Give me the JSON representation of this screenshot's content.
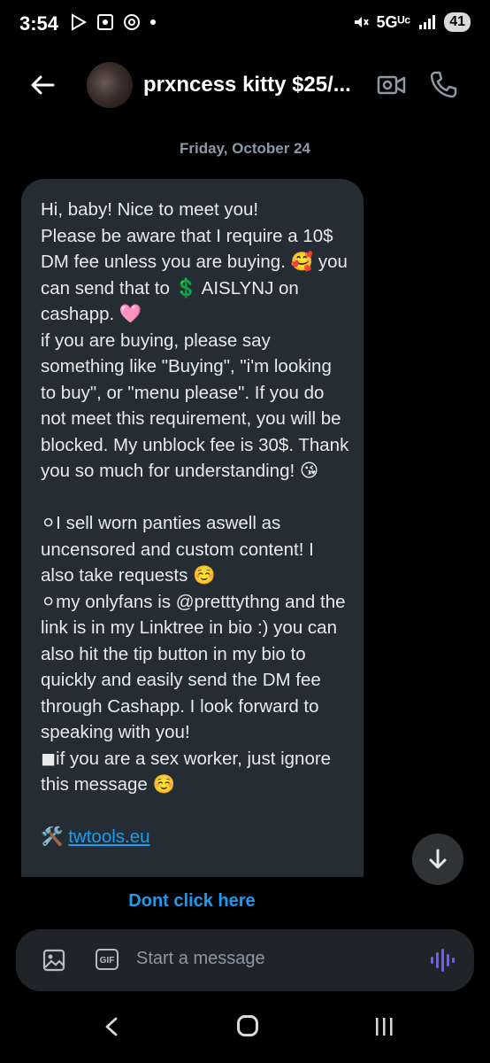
{
  "status_bar": {
    "time": "3:54",
    "network": "5Gᵁᶜ",
    "battery": "41"
  },
  "header": {
    "title": "prxncess kitty $25/...",
    "icons": [
      "back-arrow-icon",
      "video-call-icon",
      "phone-icon"
    ]
  },
  "date_divider": "Friday, October 24",
  "message": {
    "lines": [
      "Hi, baby! Nice to meet you!",
      "Please be aware that I require a 10$ DM fee unless you are buying. 🥰 you can send that to 💲 AISLYNJ on cashapp. 🩷",
      "if you are buying, please say something like \"Buying\", \"i'm looking to buy\", or \"menu please\". If you do not meet this requirement, you will be blocked. My unblock fee is 30$. Thank you so much for understanding! 😘",
      "",
      "⚪I sell worn panties aswell as uncensored and custom content! I also take requests ☺️",
      "⚪my onlyfans is @pretttythng and the link is in my Linktree in bio :) you can also hit the tip button in my bio to quickly and easily send the DM fee through Cashapp. I look forward to speaking with you!",
      "◼if you are a sex worker, just ignore this message ☺️",
      ""
    ],
    "link_prefix": "🛠️",
    "link_text": "twtools.eu"
  },
  "cta_link": "Dont click here",
  "composer": {
    "placeholder": "Start a message",
    "gif_label": "GIF"
  },
  "colors": {
    "accent": "#1d9bf0",
    "bubble": "#252d34",
    "voice": "#7856ff"
  }
}
